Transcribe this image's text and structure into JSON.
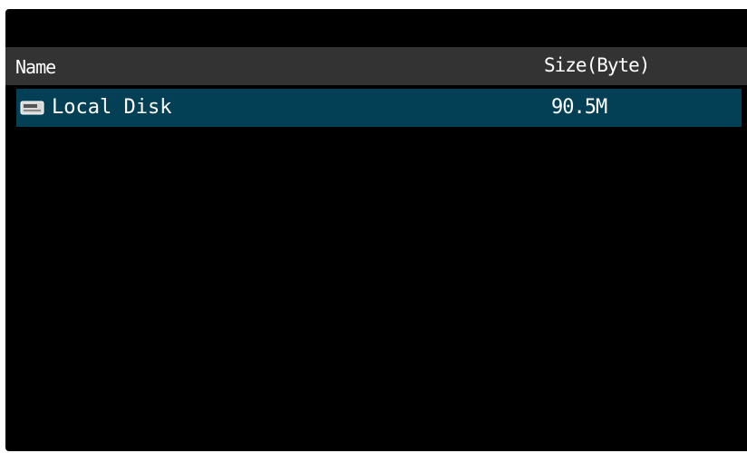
{
  "file_list": {
    "columns": {
      "name": "Name",
      "size": "Size(Byte)"
    },
    "rows": [
      {
        "icon": "disk-drive-icon",
        "name": "Local Disk",
        "size": "90.5M",
        "selected": true
      }
    ],
    "colors": {
      "background": "#000000",
      "header_background": "#333333",
      "selected_row": "#044055",
      "text": "#ffffff"
    }
  }
}
